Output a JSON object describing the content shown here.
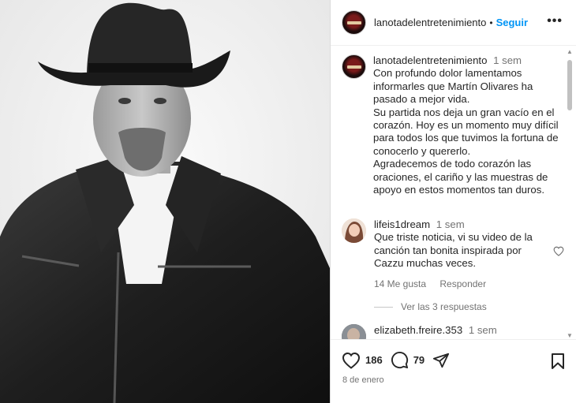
{
  "post": {
    "username": "lanotadelentretenimiento",
    "follow_label": "Seguir",
    "separator": "•",
    "more_label": "•••"
  },
  "caption": {
    "username": "lanotadelentretenimiento",
    "time": "1 sem",
    "paragraphs": [
      "Con profundo dolor lamentamos informarles que Martín Olivares ha pasado a mejor vida.",
      "Su partida nos deja un gran vacío en el corazón. Hoy es un momento muy difícil para todos los que tuvimos la fortuna de conocerlo y quererlo.",
      "Agradecemos de todo corazón las oraciones, el cariño y las muestras de apoyo en estos momentos tan duros."
    ]
  },
  "comments": [
    {
      "username": "lifeis1dream",
      "time": "1 sem",
      "text": "Que triste noticia, vi su video de la canción tan bonita inspirada por Cazzu muchas veces.",
      "likes": "14 Me gusta",
      "reply_label": "Responder",
      "view_replies": "Ver las 3 respuestas"
    },
    {
      "username": "elizabeth.freire.353",
      "time": "1 sem"
    }
  ],
  "footer": {
    "likes_count": "186",
    "comments_count": "79",
    "date": "8 de enero"
  },
  "icons": {
    "like": "heart-icon",
    "comment": "comment-icon",
    "share": "share-icon",
    "save": "bookmark-icon",
    "more": "more-icon"
  },
  "colors": {
    "follow_blue": "#0095f6",
    "text": "#262626",
    "muted": "#737373"
  }
}
